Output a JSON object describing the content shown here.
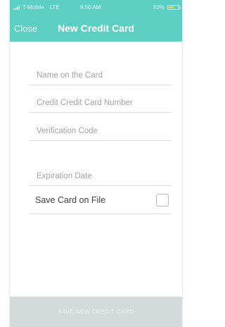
{
  "status_bar": {
    "carrier": "T-Mobile",
    "network": "LTE",
    "time": "9:50 AM",
    "battery_percent": "53%",
    "battery_level": 0.53
  },
  "nav": {
    "close_label": "Close",
    "title": "New Credit Card"
  },
  "form": {
    "name_placeholder": "Name on the Card",
    "number_placeholder": "Credit Credit Card Number",
    "verification_placeholder": "Verification Code",
    "expiration_placeholder": "Expiration Date",
    "save_card_label": "Save Card on File",
    "save_card_checked": false
  },
  "submit_label": "SAVE NEW CREDIT CARD",
  "colors": {
    "header": "#5ccfc4",
    "button_disabled": "#d3dadc",
    "battery": "#f5d72c"
  }
}
